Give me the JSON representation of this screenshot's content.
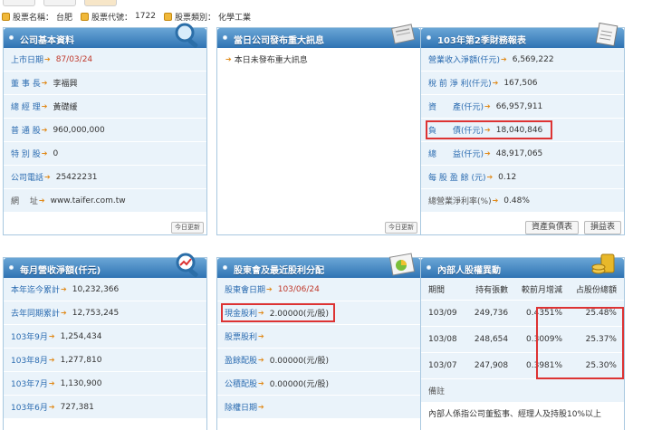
{
  "info": {
    "name_label": "股票名稱：",
    "name_value": "台肥",
    "code_label": "股票代號：",
    "code_value": "1722",
    "cat_label": "股票類別：",
    "cat_value": "化學工業"
  },
  "basic": {
    "title": "公司基本資料",
    "rows": [
      {
        "label": "上市日期",
        "value": "87/03/24"
      },
      {
        "label": "董 事 長",
        "value": "李福興"
      },
      {
        "label": "總 經 理",
        "value": "黃礎緩"
      },
      {
        "label": "普 通 股",
        "value": "960,000,000"
      },
      {
        "label": "特 別 股",
        "value": "0"
      },
      {
        "label": "公司電話",
        "value": "25422231"
      },
      {
        "label": "網　 址",
        "value": "www.taifer.com.tw"
      }
    ],
    "button": "今日更新"
  },
  "news": {
    "title": "當日公司發布重大訊息",
    "item": "本日未發布重大訊息",
    "button": "今日更新"
  },
  "finance": {
    "title": "103年第2季財務報表",
    "rows": [
      {
        "label": "營業收入淨額(仟元)",
        "value": "6,569,222"
      },
      {
        "label": "稅 前 淨 利(仟元)",
        "value": "167,506"
      },
      {
        "label": "資　　產(仟元)",
        "value": "66,957,911"
      },
      {
        "label": "負　　債(仟元)",
        "value": "18,040,846"
      },
      {
        "label": "總　　益(仟元)",
        "value": "48,917,065"
      },
      {
        "label": "每 股 盈 餘 (元)",
        "value": "0.12"
      },
      {
        "label": "總營業淨利率(%)",
        "value": "0.48%"
      }
    ],
    "btn_balance": "資產負債表",
    "btn_income": "損益表"
  },
  "revenue": {
    "title": "每月營收淨額(仟元)",
    "rows": [
      {
        "label": "本年迄今累計",
        "value": "10,232,366"
      },
      {
        "label": "去年同期累計",
        "value": "12,753,245"
      },
      {
        "label": "103年9月",
        "value": "1,254,434"
      },
      {
        "label": "103年8月",
        "value": "1,277,810"
      },
      {
        "label": "103年7月",
        "value": "1,130,900"
      },
      {
        "label": "103年6月",
        "value": "727,381"
      }
    ]
  },
  "dividend": {
    "title": "股東會及最近股利分配",
    "rows": [
      {
        "label": "股東會日期",
        "value": "103/06/24"
      },
      {
        "label": "現金股利",
        "value": "2.00000(元/股)"
      },
      {
        "label": "股票股利",
        "value": ""
      },
      {
        "label": "盈餘配股",
        "value": "0.00000(元/股)"
      },
      {
        "label": "公積配股",
        "value": "0.00000(元/股)"
      },
      {
        "label": "除權日期",
        "value": ""
      }
    ]
  },
  "insider": {
    "title": "內部人股權異動",
    "headers": [
      "期間",
      "持有張數",
      "較前月增減",
      "占股份總額"
    ],
    "rows": [
      [
        "103/09",
        "249,736",
        "0.4351%",
        "25.48%"
      ],
      [
        "103/08",
        "248,654",
        "0.3009%",
        "25.37%"
      ],
      [
        "103/07",
        "247,908",
        "0.3981%",
        "25.30%"
      ]
    ],
    "note_label": "備註",
    "note_text": "內部人係指公司董監事、經理人及持股10%以上"
  }
}
